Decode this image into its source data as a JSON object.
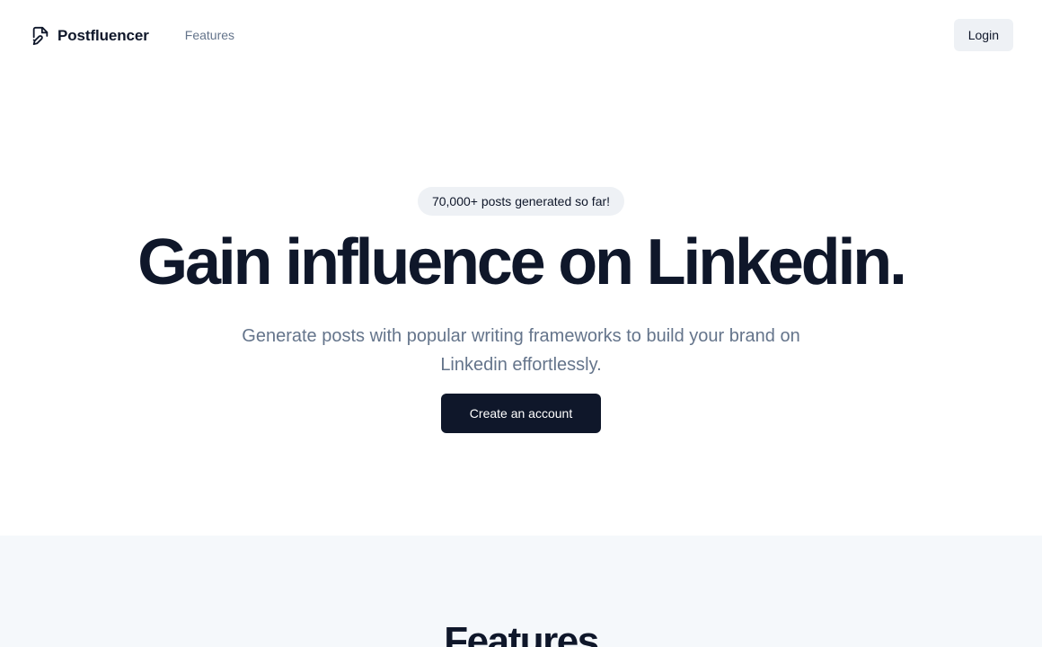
{
  "nav": {
    "brand_name": "Postfluencer",
    "brand_icon": "edit-document-icon",
    "features_link": "Features",
    "login_label": "Login"
  },
  "hero": {
    "badge": "70,000+ posts generated so far!",
    "title": "Gain influence on Linkedin.",
    "subtitle": "Generate posts with popular writing frameworks to build your brand on Linkedin effortlessly.",
    "cta_label": "Create an account"
  },
  "features": {
    "heading": "Features"
  },
  "colors": {
    "primary": "#0f172a",
    "muted_text": "#64748b",
    "secondary_bg": "#eef1f5",
    "section_bg": "#f5f8fb"
  }
}
